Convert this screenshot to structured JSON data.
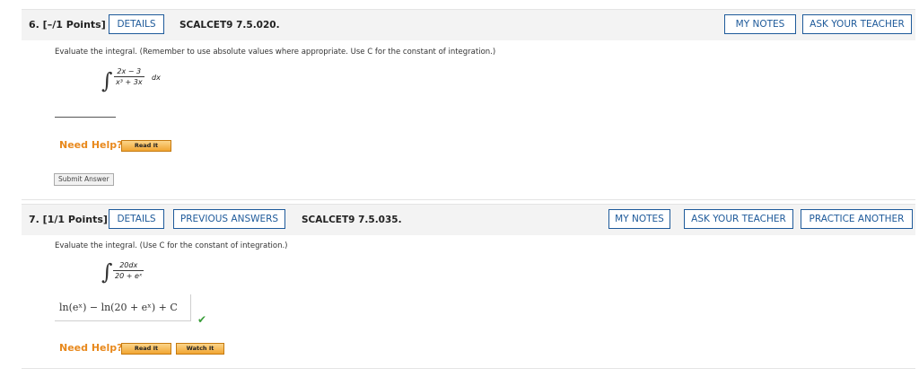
{
  "q6": {
    "number": "6. [–/1 Points]",
    "details": "DETAILS",
    "ref": "SCALCET9 7.5.020.",
    "my_notes": "MY NOTES",
    "ask_teacher": "ASK YOUR TEACHER",
    "prompt": "Evaluate the integral. (Remember to use absolute values where appropriate. Use C for the constant of integration.)",
    "integral_sign": "∫",
    "numerator": "2x − 3",
    "denominator": "x³ + 3x",
    "differential": "dx",
    "answer_value": "",
    "need_help": "Need Help?",
    "read_it": "Read It",
    "submit": "Submit Answer"
  },
  "q7": {
    "number": "7. [1/1 Points]",
    "details": "DETAILS",
    "previous_answers": "PREVIOUS ANSWERS",
    "ref": "SCALCET9 7.5.035.",
    "my_notes": "MY NOTES",
    "ask_teacher": "ASK YOUR TEACHER",
    "practice_another": "PRACTICE ANOTHER",
    "prompt": "Evaluate the integral. (Use C for the constant of integration.)",
    "integral_sign": "∫",
    "numerator": "20dx",
    "denominator": "20 + eˣ",
    "answer": "ln(eˣ) − ln(20 + eˣ) + C",
    "check": "✔",
    "need_help": "Need Help?",
    "read_it": "Read It",
    "watch_it": "Watch It"
  },
  "colors": {
    "link_blue": "#1e5a9a",
    "need_help_orange": "#e8891d",
    "check_green": "#3a9e3a",
    "header_gray": "#f3f3f3"
  }
}
